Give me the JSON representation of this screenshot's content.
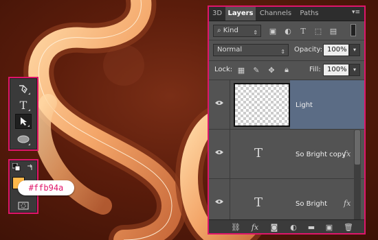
{
  "colors": {
    "highlight_border": "#e0156a",
    "foreground_color": "#ffb94a",
    "selected_layer": "#5b6c85"
  },
  "color_callout": {
    "hex": "#ffb94a"
  },
  "tools_panel": {
    "tools": [
      "pen-tool",
      "type-tool",
      "path-selection-tool",
      "ellipse-tool"
    ]
  },
  "color_panel": {
    "foreground": "#ffb94a"
  },
  "layers_panel": {
    "tabs": [
      "3D",
      "Layers",
      "Channels",
      "Paths"
    ],
    "active_tab": "Layers",
    "filter": {
      "kind_label": "Kind"
    },
    "blend_mode": "Normal",
    "opacity_label": "Opacity:",
    "opacity_value": "100%",
    "lock_label": "Lock:",
    "fill_label": "Fill:",
    "fill_value": "100%",
    "layers": [
      {
        "name": "Light",
        "type": "pixel",
        "selected": true,
        "has_fx": false
      },
      {
        "name": "So Bright copy",
        "type": "text",
        "selected": false,
        "has_fx": true
      },
      {
        "name": "So Bright",
        "type": "text",
        "selected": false,
        "has_fx": true
      }
    ],
    "fx_symbol": "fx",
    "text_thumb_glyph": "T"
  }
}
